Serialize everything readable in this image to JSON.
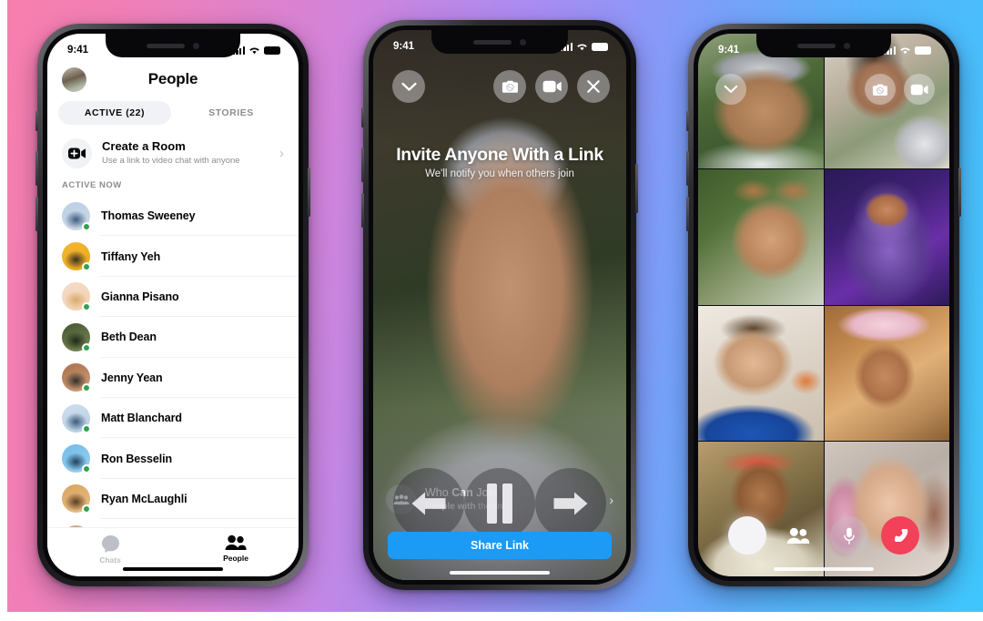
{
  "background": {
    "gradient_from": "#F77FAE",
    "gradient_mid": "#A98CF4",
    "gradient_to": "#3FC7FC"
  },
  "phone1": {
    "name": "messenger-people-list",
    "status_bar": {
      "time": "9:41",
      "signal_icon": "cellular-bars-icon",
      "wifi_icon": "wifi-icon",
      "battery_icon": "battery-full-icon"
    },
    "header": {
      "title": "People",
      "avatar_icon": "user-avatar"
    },
    "tabs": [
      {
        "label": "ACTIVE (22)",
        "active": true
      },
      {
        "label": "STORIES",
        "active": false
      }
    ],
    "create_room": {
      "title": "Create a Room",
      "subtitle": "Use a link to video chat with anyone",
      "icon": "video-camera-plus-icon",
      "chevron": "chevron-right-icon"
    },
    "section_header": "ACTIVE NOW",
    "contacts": [
      {
        "name": "Thomas Sweeney",
        "online": true,
        "avatar_colors": [
          "#b9cfe6",
          "#3e5d80",
          "#cfd9e4"
        ]
      },
      {
        "name": "Tiffany Yeh",
        "online": true,
        "avatar_colors": [
          "#f5b731",
          "#3a2d20",
          "#e8a81f"
        ]
      },
      {
        "name": "Gianna Pisano",
        "online": true,
        "avatar_colors": [
          "#f6ddc9",
          "#d8a96f",
          "#f1cfae"
        ]
      },
      {
        "name": "Beth Dean",
        "online": true,
        "avatar_colors": [
          "#46552f",
          "#1f2a16",
          "#7b8a5a"
        ]
      },
      {
        "name": "Jenny Yean",
        "online": true,
        "avatar_colors": [
          "#a8704d",
          "#33302c",
          "#cfa07a"
        ]
      },
      {
        "name": "Matt Blanchard",
        "online": true,
        "avatar_colors": [
          "#cfe0ee",
          "#3c5a7a",
          "#b7cee2"
        ]
      },
      {
        "name": "Ron Besselin",
        "online": true,
        "avatar_colors": [
          "#6fbbe8",
          "#20415c",
          "#9ed2f2"
        ]
      },
      {
        "name": "Ryan McLaughli",
        "online": true,
        "avatar_colors": [
          "#d9a35f",
          "#5a3d22",
          "#e8c087"
        ]
      },
      {
        "name": "",
        "online": false,
        "avatar_colors": [
          "#c6a68a",
          "#5a4433",
          "#ddc3a6"
        ]
      }
    ],
    "bottom_nav": [
      {
        "label": "Chats",
        "icon": "chat-bubble-icon",
        "active": false
      },
      {
        "label": "People",
        "icon": "people-icon",
        "active": true
      }
    ]
  },
  "phone2": {
    "name": "room-invite-screen",
    "status_bar": {
      "time": "9:41",
      "signal_icon": "cellular-bars-icon",
      "wifi_icon": "wifi-icon",
      "battery_icon": "battery-full-icon"
    },
    "minimize_icon": "chevron-down-icon",
    "top_controls": [
      {
        "icon": "camera-flip-icon",
        "name": "flip-camera-button"
      },
      {
        "icon": "video-camera-icon",
        "name": "toggle-video-button"
      },
      {
        "icon": "close-x-icon",
        "name": "close-room-button"
      }
    ],
    "invite": {
      "title": "Invite Anyone With a Link",
      "subtitle": "We'll notify you when others join"
    },
    "who_can_join": {
      "title_prefix": "Who ",
      "title_bold": "Can",
      "title_suffix": " Join",
      "subtitle_prefix": "Pe",
      "subtitle_bold": "ople with",
      "subtitle_suffix": " the link",
      "icon": "people-group-icon",
      "chevron": "chevron-right-icon"
    },
    "player_overlay": {
      "prev_icon": "arrow-left-icon",
      "pause_icon": "pause-icon",
      "next_icon": "arrow-right-icon"
    },
    "share_button": {
      "label": "Share Link",
      "color": "#1b9bf5"
    }
  },
  "phone3": {
    "name": "group-video-call-grid",
    "status_bar": {
      "time": "9:41",
      "signal_icon": "cellular-bars-icon",
      "wifi_icon": "wifi-icon",
      "battery_icon": "battery-full-icon"
    },
    "minimize_icon": "chevron-down-icon",
    "top_controls": [
      {
        "icon": "camera-flip-icon",
        "name": "flip-camera-button"
      },
      {
        "icon": "video-camera-icon",
        "name": "toggle-video-button"
      }
    ],
    "participants": [
      {
        "position": "r1c1",
        "description": "man in grey cap outdoors"
      },
      {
        "position": "r1c2",
        "description": "woman resting chin on hand, striped top"
      },
      {
        "position": "r2c1",
        "description": "man with bear-ears filter and glasses, plant behind"
      },
      {
        "position": "r2c2",
        "description": "astronaut avatar filter on purple space background"
      },
      {
        "position": "r3c1",
        "description": "man in blue hoodie indoors"
      },
      {
        "position": "r3c2",
        "description": "woman with flower-crown filter, curly hair"
      },
      {
        "position": "r4c1",
        "description": "woman with cat-ears filter making peace sign"
      },
      {
        "position": "r4c2",
        "description": "woman with pink hair smiling"
      }
    ],
    "bottom_controls": [
      {
        "icon": "shutter-circle-icon",
        "name": "capture-button"
      },
      {
        "icon": "people-icon",
        "name": "participants-button"
      },
      {
        "icon": "microphone-icon",
        "name": "mute-button"
      },
      {
        "icon": "end-call-icon",
        "name": "end-call-button",
        "color": "#f3415a"
      }
    ]
  }
}
